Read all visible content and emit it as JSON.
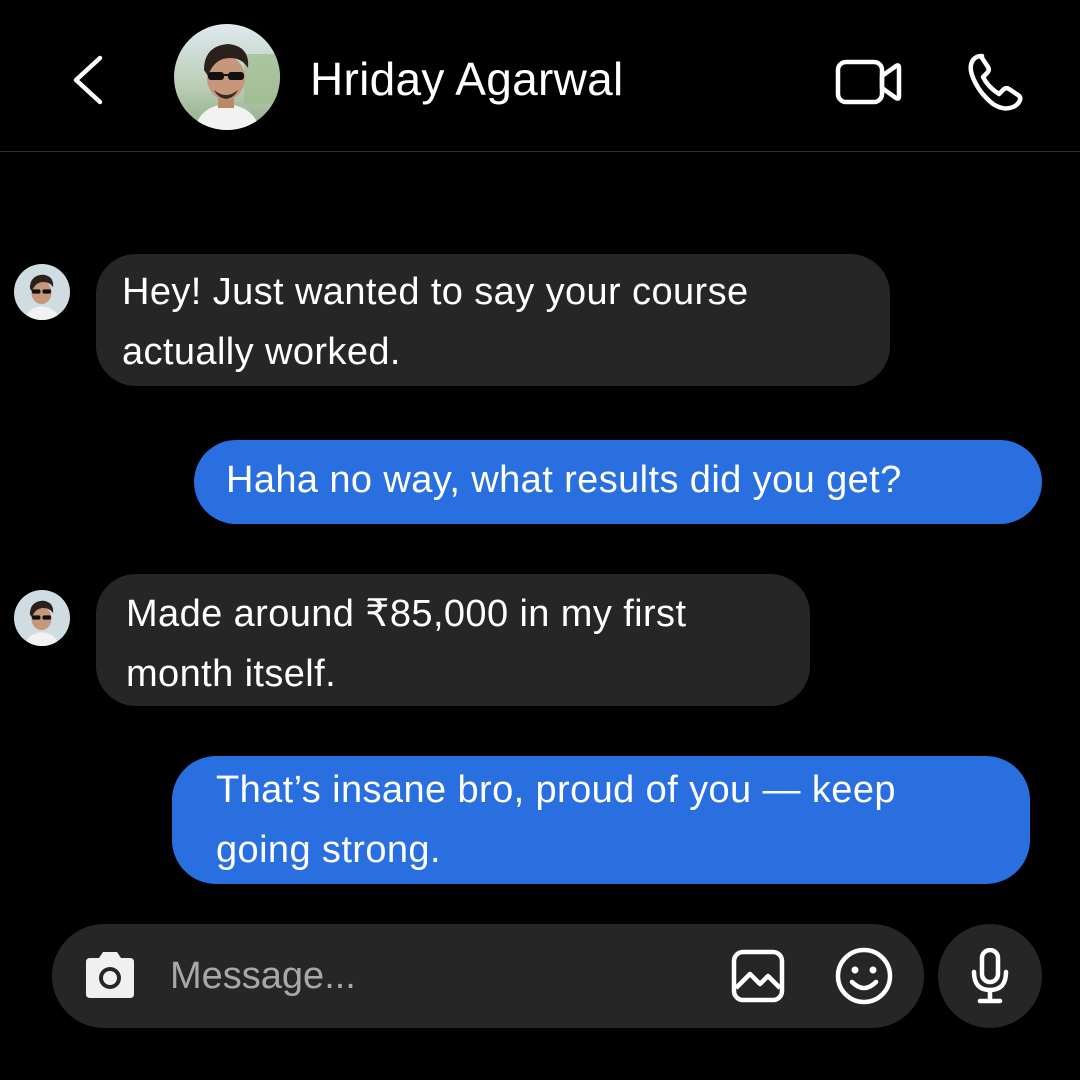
{
  "header": {
    "contact_name": "Hriday Agarwal",
    "back_icon": "chevron-left-icon",
    "video_icon": "video-camera-icon",
    "call_icon": "phone-icon"
  },
  "messages": [
    {
      "direction": "incoming",
      "text": "Hey! Just wanted to say your course\nactually worked."
    },
    {
      "direction": "outgoing",
      "text": "Haha no way, what results did you get?"
    },
    {
      "direction": "incoming",
      "text": "Made around ₹85,000 in my first\nmonth itself."
    },
    {
      "direction": "outgoing",
      "text": "That’s insane bro, proud of you — keep\ngoing strong."
    }
  ],
  "composer": {
    "placeholder": "Message...",
    "camera_icon": "camera-icon",
    "gallery_icon": "image-icon",
    "emoji_icon": "smiley-icon",
    "mic_icon": "microphone-icon"
  },
  "colors": {
    "background": "#000000",
    "incoming_bubble": "#262626",
    "outgoing_bubble": "#2a6fe0",
    "text": "#ffffff",
    "placeholder": "#a8a8a8"
  }
}
